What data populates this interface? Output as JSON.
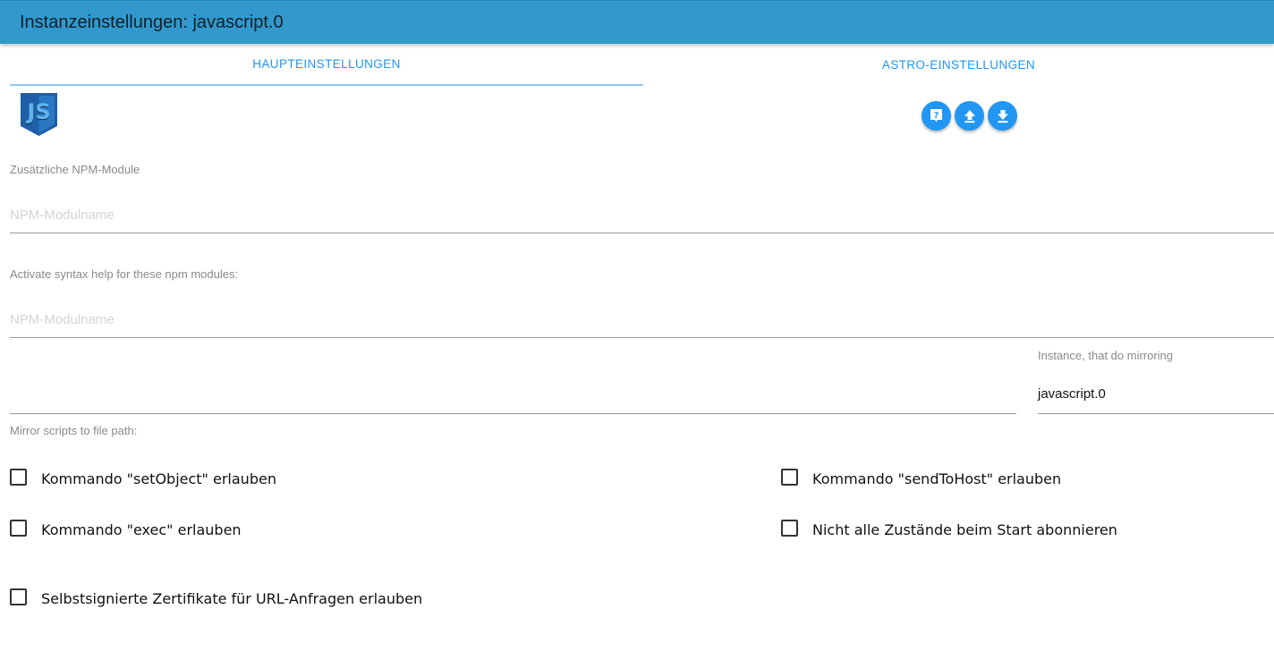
{
  "header": {
    "title": "Instanzeinstellungen: javascript.0"
  },
  "tabs": [
    {
      "label": "HAUPTEINSTELLUNGEN",
      "active": true
    },
    {
      "label": "ASTRO-EINSTELLUNGEN",
      "active": false
    }
  ],
  "logo": {
    "icon": "js-shield-logo",
    "text": "JS"
  },
  "action_buttons": [
    {
      "icon": "help-icon"
    },
    {
      "icon": "upload-icon"
    },
    {
      "icon": "download-icon"
    }
  ],
  "npm_modules": {
    "label": "Zusätzliche NPM-Module",
    "placeholder": "NPM-Modulname",
    "value": ""
  },
  "syntax_help": {
    "label": "Activate syntax help for these npm modules:",
    "placeholder": "NPM-Modulname",
    "value": ""
  },
  "mirror_path": {
    "label": "Mirror scripts to file path:",
    "value": ""
  },
  "mirror_instance": {
    "label": "Instance, that do mirroring",
    "value": "javascript.0"
  },
  "checkboxes": {
    "set_object": {
      "label": "Kommando \"setObject\" erlauben",
      "checked": false
    },
    "send_to_host": {
      "label": "Kommando \"sendToHost\" erlauben",
      "checked": false
    },
    "exec": {
      "label": "Kommando \"exec\" erlauben",
      "checked": false
    },
    "no_subscribe": {
      "label": "Nicht alle Zustände beim Start abonnieren",
      "checked": false
    },
    "self_signed": {
      "label": "Selbstsignierte Zertifikate für URL-Anfragen erlauben",
      "checked": false
    }
  },
  "colors": {
    "header_bg": "#3399cc",
    "accent": "#2196f3",
    "logo_blue": "#1e6bb8"
  }
}
